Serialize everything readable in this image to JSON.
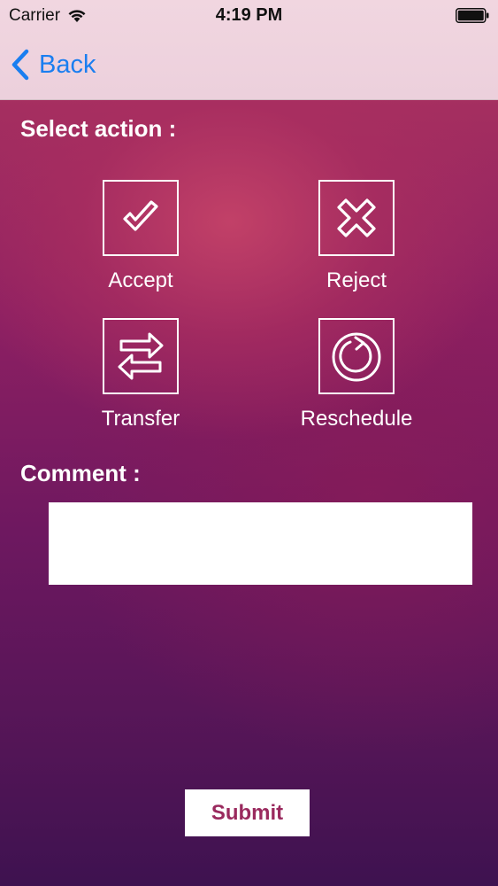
{
  "status_bar": {
    "carrier": "Carrier",
    "time": "4:19 PM"
  },
  "nav": {
    "back_label": "Back"
  },
  "select_action_label": "Select action :",
  "actions": [
    {
      "label": "Accept",
      "icon": "check-icon"
    },
    {
      "label": "Reject",
      "icon": "cross-icon"
    },
    {
      "label": "Transfer",
      "icon": "transfer-arrows-icon"
    },
    {
      "label": "Reschedule",
      "icon": "reschedule-refresh-icon"
    }
  ],
  "comment": {
    "label": "Comment :",
    "value": "",
    "placeholder": ""
  },
  "submit_label": "Submit",
  "colors": {
    "nav_bar": "#ecd0dc",
    "link_blue": "#1a7ef0",
    "background_top": "#b0365f",
    "background_bottom": "#3e1250",
    "submit_text": "#9a2a5e"
  }
}
